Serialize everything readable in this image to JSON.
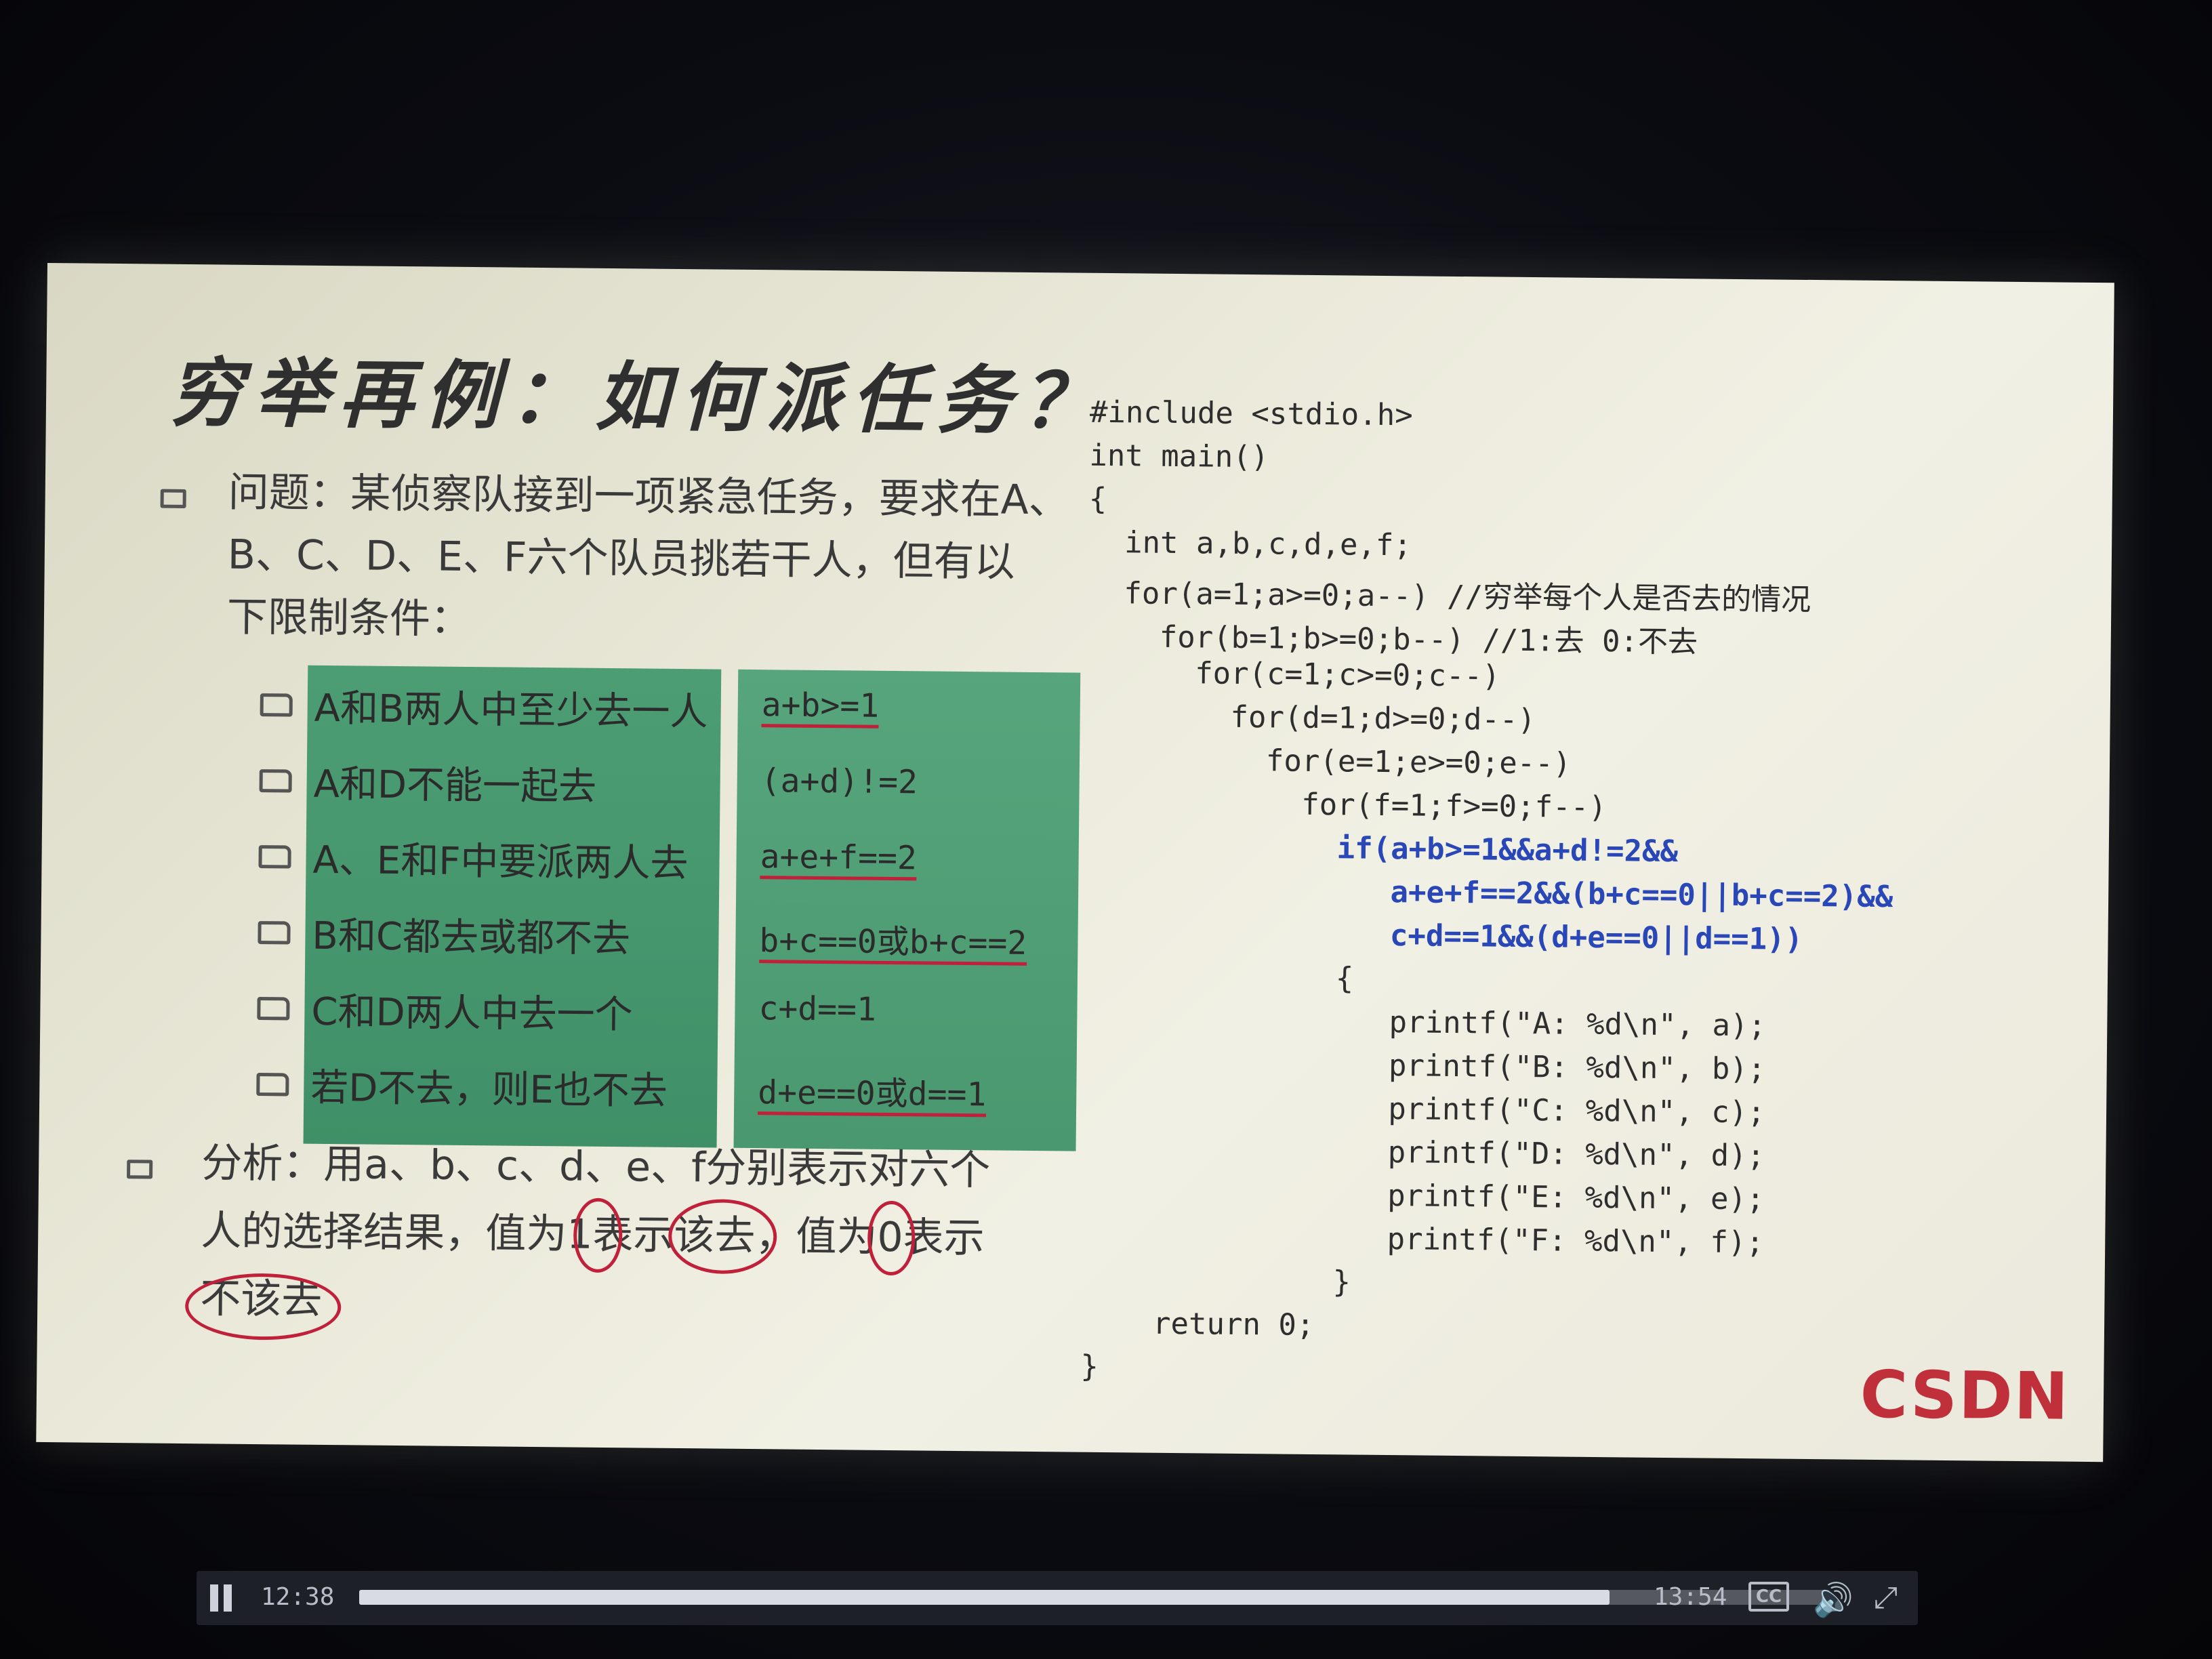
{
  "slide": {
    "title": "穷举再例：如何派任务？",
    "problem_lines": [
      "问题：某侦察队接到一项紧急任务，要求在A、",
      "B、C、D、E、F六个队员挑若干人，但有以",
      "下限制条件："
    ],
    "conditions": [
      {
        "text": "A和B两人中至少去一人",
        "expr": "a+b>=1"
      },
      {
        "text": "A和D不能一起去",
        "expr": "(a+d)!=2"
      },
      {
        "text": "A、E和F中要派两人去",
        "expr": "a+e+f==2"
      },
      {
        "text": "B和C都去或都不去",
        "expr": "b+c==0或b+c==2"
      },
      {
        "text": "C和D两人中去一个",
        "expr": "c+d==1"
      },
      {
        "text": "若D不去，则E也不去",
        "expr": "d+e==0或d==1"
      }
    ],
    "analysis_lines": [
      "分析：用a、b、c、d、e、f分别表示对六个",
      "人的选择结果，值为1表示该去，值为0表示",
      "不该去"
    ],
    "code": [
      "#include <stdio.h>",
      "int main()",
      "{",
      "  int a,b,c,d,e,f;",
      "  for(a=1;a>=0;a--) //穷举每个人是否去的情况",
      "    for(b=1;b>=0;b--) //1:去 0:不去",
      "      for(c=1;c>=0;c--)",
      "        for(d=1;d>=0;d--)",
      "          for(e=1;e>=0;e--)",
      "            for(f=1;f>=0;f--)",
      "              if(a+b>=1&&a+d!=2&&",
      "                 a+e+f==2&&(b+c==0||b+c==2)&&",
      "                 c+d==1&&(d+e==0||d==1))",
      "              {",
      "                 printf(\"A: %d\\n\", a);",
      "                 printf(\"B: %d\\n\", b);",
      "                 printf(\"C: %d\\n\", c);",
      "                 printf(\"D: %d\\n\", d);",
      "                 printf(\"E: %d\\n\", e);",
      "                 printf(\"F: %d\\n\", f);",
      "              }",
      "    return 0;",
      "}"
    ],
    "logo": "CSDN"
  },
  "player": {
    "current_time": "12:38",
    "total_time": "13:54",
    "cc_label": "CC",
    "progress": 0.85,
    "icons": [
      "pause-icon",
      "cc-icon",
      "volume-icon",
      "fullscreen-icon"
    ],
    "accent_color": "#d8dbe2"
  }
}
